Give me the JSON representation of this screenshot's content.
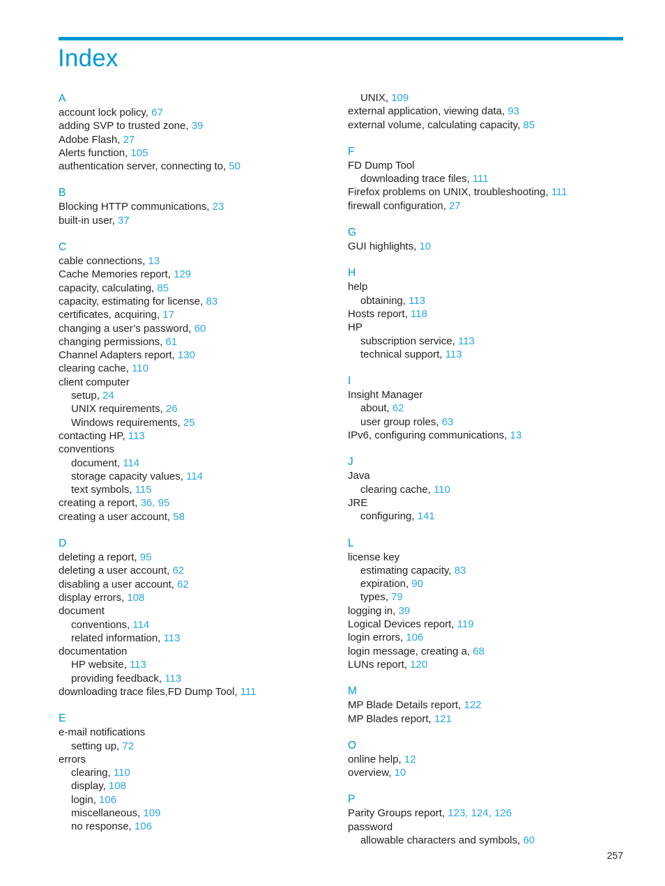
{
  "page": {
    "title": "Index",
    "folio": "257",
    "accent_color": "#0096d6",
    "page_number_color": "#29a8e0",
    "text_color": "#231f20"
  },
  "columns": [
    {
      "name": "left-column",
      "sections": [
        {
          "letter": "A",
          "entries": [
            {
              "level": 1,
              "text": "account lock policy,",
              "pages": "67"
            },
            {
              "level": 1,
              "text": "adding SVP to trusted zone,",
              "pages": "39"
            },
            {
              "level": 1,
              "text": "Adobe Flash,",
              "pages": "27"
            },
            {
              "level": 1,
              "text": "Alerts function,",
              "pages": "105"
            },
            {
              "level": 1,
              "text": "authentication server, connecting to,",
              "pages": "50"
            }
          ]
        },
        {
          "letter": "B",
          "entries": [
            {
              "level": 1,
              "text": "Blocking HTTP communications,",
              "pages": "23"
            },
            {
              "level": 1,
              "text": "built-in user,",
              "pages": "37"
            }
          ]
        },
        {
          "letter": "C",
          "entries": [
            {
              "level": 1,
              "text": "cable connections,",
              "pages": "13"
            },
            {
              "level": 1,
              "text": "Cache Memories report,",
              "pages": "129"
            },
            {
              "level": 1,
              "text": "capacity, calculating,",
              "pages": "85"
            },
            {
              "level": 1,
              "text": "capacity, estimating for license,",
              "pages": "83"
            },
            {
              "level": 1,
              "text": "certificates, acquiring,",
              "pages": "17"
            },
            {
              "level": 1,
              "text": "changing a user’s password,",
              "pages": "60"
            },
            {
              "level": 1,
              "text": "changing permissions,",
              "pages": "61"
            },
            {
              "level": 1,
              "text": "Channel Adapters report,",
              "pages": "130"
            },
            {
              "level": 1,
              "text": "clearing cache,",
              "pages": "110"
            },
            {
              "level": 1,
              "text": "client computer",
              "pages": ""
            },
            {
              "level": 2,
              "text": "setup,",
              "pages": "24"
            },
            {
              "level": 2,
              "text": "UNIX requirements,",
              "pages": "26"
            },
            {
              "level": 2,
              "text": "Windows requirements,",
              "pages": "25"
            },
            {
              "level": 1,
              "text": "contacting HP,",
              "pages": "113"
            },
            {
              "level": 1,
              "text": "conventions",
              "pages": ""
            },
            {
              "level": 2,
              "text": "document,",
              "pages": "114"
            },
            {
              "level": 2,
              "text": "storage capacity values,",
              "pages": "114"
            },
            {
              "level": 2,
              "text": "text symbols,",
              "pages": "115"
            },
            {
              "level": 1,
              "text": "creating a report,",
              "pages": "36, 95"
            },
            {
              "level": 1,
              "text": "creating a user account,",
              "pages": "58"
            }
          ]
        },
        {
          "letter": "D",
          "entries": [
            {
              "level": 1,
              "text": "deleting a report,",
              "pages": "95"
            },
            {
              "level": 1,
              "text": "deleting a user account,",
              "pages": "62"
            },
            {
              "level": 1,
              "text": "disabling a user account,",
              "pages": "62"
            },
            {
              "level": 1,
              "text": "display errors,",
              "pages": "108"
            },
            {
              "level": 1,
              "text": "document",
              "pages": ""
            },
            {
              "level": 2,
              "text": "conventions,",
              "pages": "114"
            },
            {
              "level": 2,
              "text": "related information,",
              "pages": "113"
            },
            {
              "level": 1,
              "text": "documentation",
              "pages": ""
            },
            {
              "level": 2,
              "text": "HP website,",
              "pages": "113"
            },
            {
              "level": 2,
              "text": "providing feedback,",
              "pages": "113"
            },
            {
              "level": 1,
              "text": "downloading trace files,FD Dump Tool,",
              "pages": "111"
            }
          ]
        },
        {
          "letter": "E",
          "entries": [
            {
              "level": 1,
              "text": "e-mail notifications",
              "pages": ""
            },
            {
              "level": 2,
              "text": "setting up,",
              "pages": "72"
            },
            {
              "level": 1,
              "text": "errors",
              "pages": ""
            },
            {
              "level": 2,
              "text": "clearing,",
              "pages": "110"
            },
            {
              "level": 2,
              "text": "display,",
              "pages": "108"
            },
            {
              "level": 2,
              "text": "login,",
              "pages": "106"
            },
            {
              "level": 2,
              "text": "miscellaneous,",
              "pages": "109"
            },
            {
              "level": 2,
              "text": "no response,",
              "pages": "106"
            }
          ]
        }
      ]
    },
    {
      "name": "right-column",
      "sections": [
        {
          "letter": "",
          "entries": [
            {
              "level": 2,
              "text": "UNIX,",
              "pages": "109"
            },
            {
              "level": 1,
              "text": "external application, viewing data,",
              "pages": "93"
            },
            {
              "level": 1,
              "text": "external volume, calculating capacity,",
              "pages": "85"
            }
          ]
        },
        {
          "letter": "F",
          "entries": [
            {
              "level": 1,
              "text": "FD Dump Tool",
              "pages": ""
            },
            {
              "level": 2,
              "text": "downloading trace files,",
              "pages": "111"
            },
            {
              "level": 1,
              "text": "Firefox problems on UNIX, troubleshooting,",
              "pages": "111"
            },
            {
              "level": 1,
              "text": "firewall configuration,",
              "pages": "27"
            }
          ]
        },
        {
          "letter": "G",
          "entries": [
            {
              "level": 1,
              "text": "GUI highlights,",
              "pages": "10"
            }
          ]
        },
        {
          "letter": "H",
          "entries": [
            {
              "level": 1,
              "text": "help",
              "pages": ""
            },
            {
              "level": 2,
              "text": "obtaining,",
              "pages": "113"
            },
            {
              "level": 1,
              "text": "Hosts report,",
              "pages": "118"
            },
            {
              "level": 1,
              "text": "HP",
              "pages": ""
            },
            {
              "level": 2,
              "text": "subscription service,",
              "pages": "113"
            },
            {
              "level": 2,
              "text": "technical support,",
              "pages": "113"
            }
          ]
        },
        {
          "letter": "I",
          "entries": [
            {
              "level": 1,
              "text": "Insight Manager",
              "pages": ""
            },
            {
              "level": 2,
              "text": "about,",
              "pages": "62"
            },
            {
              "level": 2,
              "text": "user group roles,",
              "pages": "63"
            },
            {
              "level": 1,
              "text": "IPv6, configuring communications,",
              "pages": "13"
            }
          ]
        },
        {
          "letter": "J",
          "entries": [
            {
              "level": 1,
              "text": "Java",
              "pages": ""
            },
            {
              "level": 2,
              "text": "clearing cache,",
              "pages": "110"
            },
            {
              "level": 1,
              "text": "JRE",
              "pages": ""
            },
            {
              "level": 2,
              "text": "configuring,",
              "pages": "141"
            }
          ]
        },
        {
          "letter": "L",
          "entries": [
            {
              "level": 1,
              "text": "license key",
              "pages": ""
            },
            {
              "level": 2,
              "text": "estimating capacity,",
              "pages": "83"
            },
            {
              "level": 2,
              "text": "expiration,",
              "pages": "90"
            },
            {
              "level": 2,
              "text": "types,",
              "pages": "79"
            },
            {
              "level": 1,
              "text": "logging in,",
              "pages": "39"
            },
            {
              "level": 1,
              "text": "Logical Devices report,",
              "pages": "119"
            },
            {
              "level": 1,
              "text": "login errors,",
              "pages": "106"
            },
            {
              "level": 1,
              "text": "login message, creating a,",
              "pages": "68"
            },
            {
              "level": 1,
              "text": "LUNs report,",
              "pages": "120"
            }
          ]
        },
        {
          "letter": "M",
          "entries": [
            {
              "level": 1,
              "text": "MP Blade Details report,",
              "pages": "122"
            },
            {
              "level": 1,
              "text": "MP Blades report,",
              "pages": "121"
            }
          ]
        },
        {
          "letter": "O",
          "entries": [
            {
              "level": 1,
              "text": "online help,",
              "pages": "12"
            },
            {
              "level": 1,
              "text": "overview,",
              "pages": "10"
            }
          ]
        },
        {
          "letter": "P",
          "entries": [
            {
              "level": 1,
              "text": "Parity Groups report,",
              "pages": "123, 124, 126"
            },
            {
              "level": 1,
              "text": "password",
              "pages": ""
            },
            {
              "level": 2,
              "text": "allowable characters and symbols,",
              "pages": "60"
            }
          ]
        }
      ]
    }
  ]
}
